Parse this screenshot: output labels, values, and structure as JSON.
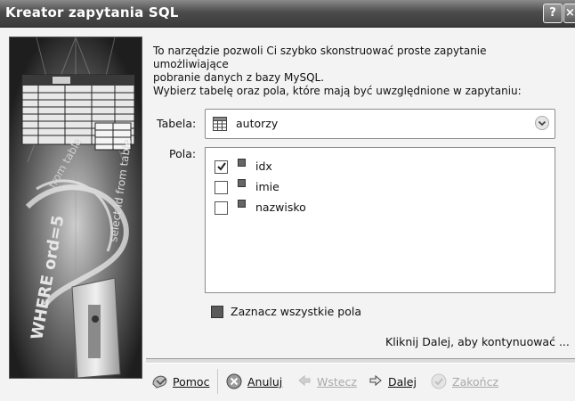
{
  "window": {
    "title": "Kreator zapytania SQL",
    "help_glyph": "?",
    "close_glyph": "×"
  },
  "intro": {
    "line1": "To narzędzie pozwoli Ci szybko skonstruować proste zapytanie umożliwiające",
    "line2": "pobranie danych z bazy MySQL.",
    "choose": "Wybierz tabelę oraz pola, które mają być uwzględnione w zapytaniu:"
  },
  "table": {
    "label": "Tabela:",
    "value": "autorzy",
    "icon": "table-icon"
  },
  "fields": {
    "label": "Pola:",
    "items": [
      {
        "name": "idx",
        "checked": true
      },
      {
        "name": "imie",
        "checked": false
      },
      {
        "name": "nazwisko",
        "checked": false
      }
    ]
  },
  "select_all": "Zaznacz wszystkie pola",
  "continue_hint": "Kliknij Dalej, aby kontynuować ...",
  "buttons": {
    "help": {
      "label": "Pomoc",
      "icon": "help-icon"
    },
    "cancel": {
      "label": "Anuluj",
      "icon": "cancel-icon"
    },
    "back": {
      "label": "Wstecz",
      "icon": "arrow-left-icon",
      "enabled": false
    },
    "next": {
      "label": "Dalej",
      "icon": "arrow-right-icon",
      "enabled": true
    },
    "finish": {
      "label": "Zakończ",
      "icon": "finish-icon",
      "enabled": false
    }
  },
  "side_art": {
    "text1": "WHERE ord=5",
    "text2": "select id from table",
    "text3": "from table"
  }
}
